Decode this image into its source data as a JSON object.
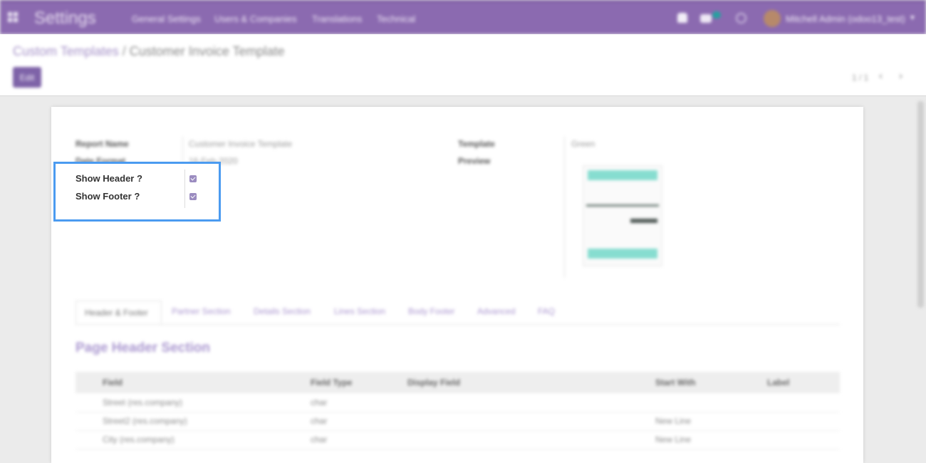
{
  "navbar": {
    "app_title": "Settings",
    "menu": [
      "General Settings",
      "Users & Companies",
      "Translations",
      "Technical"
    ],
    "user_name": "Mitchell Admin (odoo13_test)",
    "colors": {
      "navbar": "#8b6ab0",
      "accent": "#7e63a8"
    }
  },
  "breadcrumb": {
    "parent": "Custom Templates",
    "separator": "/",
    "current": "Customer Invoice Template"
  },
  "toolbar": {
    "edit_label": "Edit"
  },
  "pager": {
    "text": "1 / 1",
    "prev": "‹",
    "next": "›"
  },
  "form": {
    "report_name_label": "Report Name",
    "report_name_value": "Customer Invoice Template",
    "date_format_label": "Date Format",
    "date_format_value": "16-Feb-2020",
    "template_label": "Template",
    "template_value": "Green",
    "preview_label": "Preview",
    "show_header_label": "Show Header ?",
    "show_header_checked": true,
    "show_footer_label": "Show Footer ?",
    "show_footer_checked": true
  },
  "tabs": [
    "Header & Footer",
    "Partner Section",
    "Details Section",
    "Lines Section",
    "Body Footer",
    "Advanced",
    "FAQ"
  ],
  "section_title": "Page Header Section",
  "table": {
    "headers": [
      "Field",
      "Field Type",
      "Display Field",
      "Start With",
      "Label"
    ],
    "rows": [
      [
        "Street (res.company)",
        "char",
        "",
        "",
        ""
      ],
      [
        "Street2 (res.company)",
        "char",
        "",
        "New Line",
        ""
      ],
      [
        "City (res.company)",
        "char",
        "",
        "New Line",
        ""
      ]
    ]
  }
}
